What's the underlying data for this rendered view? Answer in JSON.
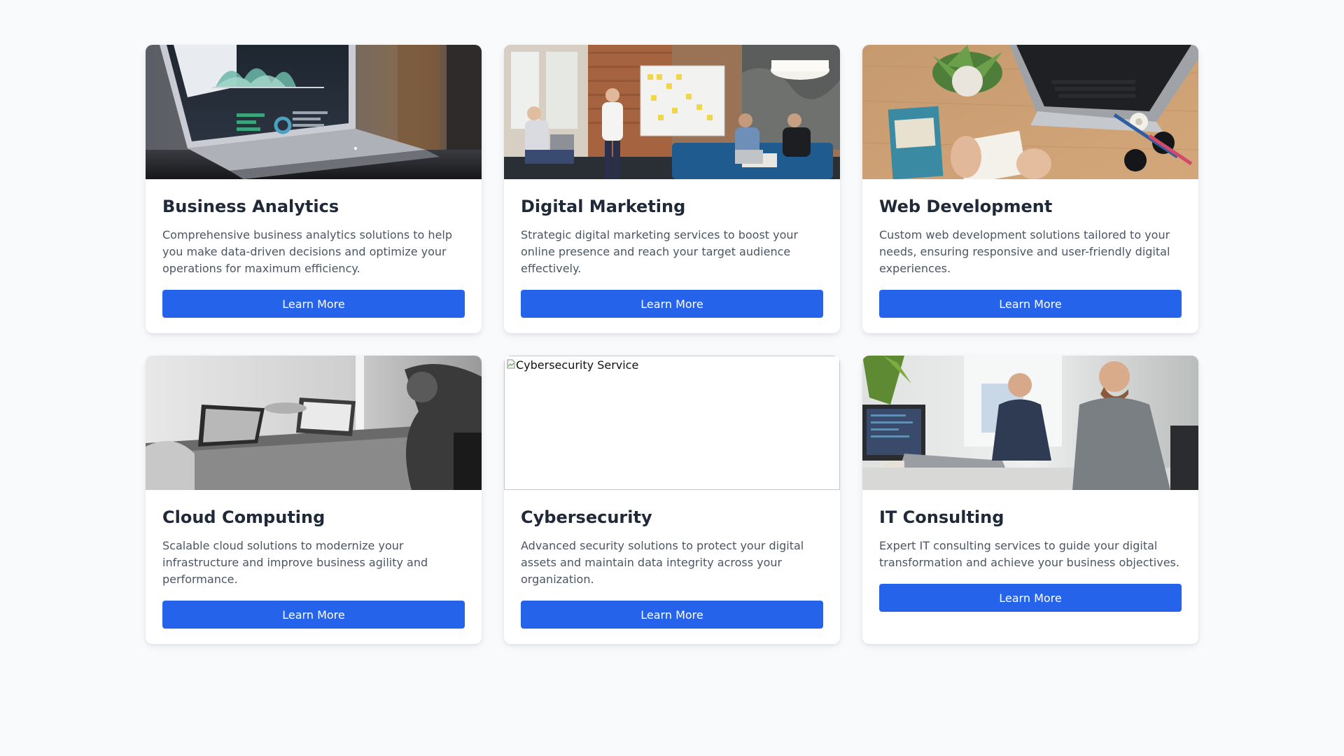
{
  "theme": {
    "page_background": "#f8fafc",
    "card_background": "#ffffff",
    "button_color": "#2563eb",
    "title_color": "#1f2937",
    "text_color": "#4b5563"
  },
  "cards": [
    {
      "title": "Business Analytics",
      "description": "Comprehensive business analytics solutions to help you make data-driven decisions and optimize your operations for maximum efficiency.",
      "button_label": "Learn More",
      "image": "photo: laptop showing analytics dashboard"
    },
    {
      "title": "Digital Marketing",
      "description": "Strategic digital marketing services to boost your online presence and reach your target audience effectively.",
      "button_label": "Learn More",
      "image": "photo: team meeting around whiteboard with sticky notes"
    },
    {
      "title": "Web Development",
      "description": "Custom web development solutions tailored to your needs, ensuring responsive and user-friendly digital experiences.",
      "button_label": "Learn More",
      "image": "photo: desk with laptop, plant and book"
    },
    {
      "title": "Cloud Computing",
      "description": "Scalable cloud solutions to modernize your infrastructure and improve business agility and performance.",
      "button_label": "Learn More",
      "image": "photo: black and white people with laptops"
    },
    {
      "title": "Cybersecurity",
      "description": "Advanced security solutions to protect your digital assets and maintain data integrity across your organization.",
      "button_label": "Learn More",
      "image_alt": "Cybersecurity Service",
      "image_broken": true
    },
    {
      "title": "IT Consulting",
      "description": "Expert IT consulting services to guide your digital transformation and achieve your business objectives.",
      "button_label": "Learn More",
      "image": "photo: two men working at computers"
    }
  ]
}
